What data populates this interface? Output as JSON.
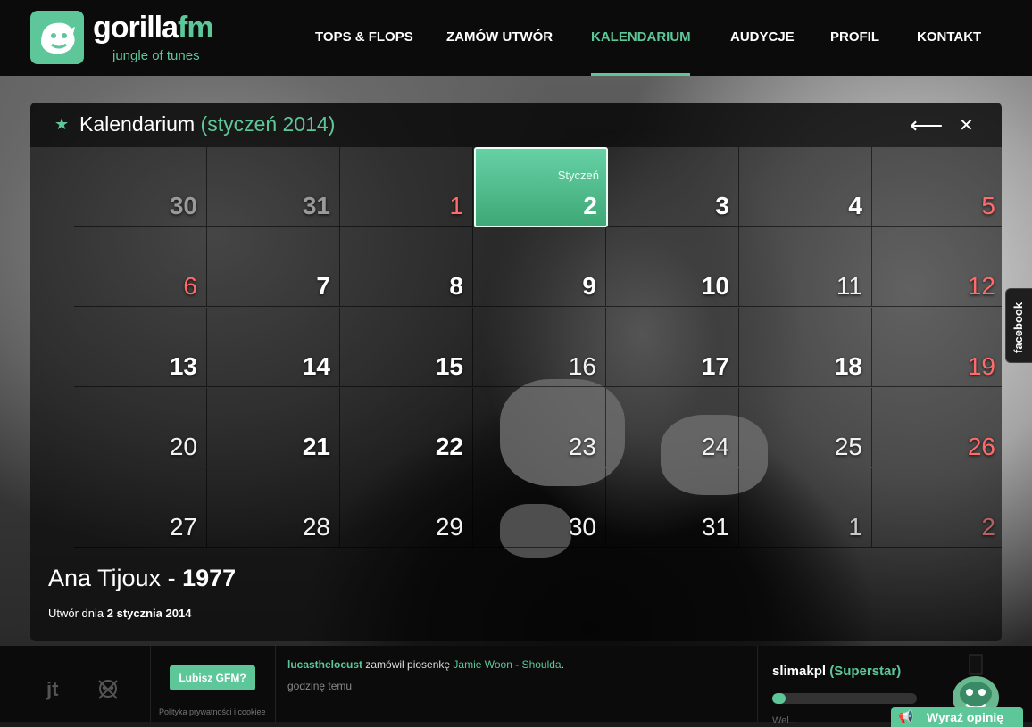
{
  "header": {
    "brand_white": "gorilla",
    "brand_green": "fm",
    "tagline": "jungle of tunes",
    "nav": [
      "TOPS & FLOPS",
      "ZAMÓW UTWÓR",
      "KALENDARIUM",
      "AUDYCJE",
      "PROFIL",
      "KONTAKT"
    ],
    "active_nav": "KALENDARIUM"
  },
  "calendar": {
    "title": "Kalendarium",
    "month_label": "(styczeń 2014)",
    "selected_month_label": "Styczeń",
    "weeks": [
      [
        {
          "d": "30",
          "t": "other"
        },
        {
          "d": "31",
          "t": "other"
        },
        {
          "d": "1",
          "t": "sun"
        },
        {
          "d": "2",
          "t": "selected"
        },
        {
          "d": "3",
          "t": "bold"
        },
        {
          "d": "4",
          "t": "bold"
        },
        {
          "d": "5",
          "t": "sun"
        }
      ],
      [
        {
          "d": "6",
          "t": "sun"
        },
        {
          "d": "7",
          "t": "bold"
        },
        {
          "d": "8",
          "t": "bold"
        },
        {
          "d": "9",
          "t": "bold"
        },
        {
          "d": "10",
          "t": "bold"
        },
        {
          "d": "11",
          "t": "light"
        },
        {
          "d": "12",
          "t": "sun light"
        }
      ],
      [
        {
          "d": "13",
          "t": "bold"
        },
        {
          "d": "14",
          "t": "bold"
        },
        {
          "d": "15",
          "t": "bold"
        },
        {
          "d": "16",
          "t": "light"
        },
        {
          "d": "17",
          "t": "bold"
        },
        {
          "d": "18",
          "t": "bold"
        },
        {
          "d": "19",
          "t": "sun"
        }
      ],
      [
        {
          "d": "20",
          "t": "light"
        },
        {
          "d": "21",
          "t": "bold"
        },
        {
          "d": "22",
          "t": "bold"
        },
        {
          "d": "23",
          "t": "light"
        },
        {
          "d": "24",
          "t": "light"
        },
        {
          "d": "25",
          "t": "light"
        },
        {
          "d": "26",
          "t": "sun light"
        }
      ],
      [
        {
          "d": "27",
          "t": "light"
        },
        {
          "d": "28",
          "t": "light"
        },
        {
          "d": "29",
          "t": "light"
        },
        {
          "d": "30",
          "t": "light"
        },
        {
          "d": "31",
          "t": "light"
        },
        {
          "d": "1",
          "t": "other light"
        },
        {
          "d": "2",
          "t": "other sun"
        }
      ]
    ],
    "song_artist": "Ana Tijoux - ",
    "song_title": "1977",
    "date_prefix": "Utwór dnia ",
    "date_value": "2 stycznia 2014"
  },
  "side_tab": {
    "label": "facebook"
  },
  "footer": {
    "jt": "jt",
    "like_button": "Lubisz GFM?",
    "privacy": "Polityka prywatności i cookiee",
    "activity_user": "lucasthelocust",
    "activity_text": " zamówił piosenkę ",
    "activity_track": "Jamie Woon - Shoulda",
    "activity_end": ".",
    "activity_time": "godzinę temu",
    "username": "slimakpl",
    "rank": "(Superstar)",
    "progress": 0.09,
    "welcome": "Wel...",
    "opinion_button": "Wyraź opinię"
  },
  "colors": {
    "accent": "#5ec79a",
    "sunday": "#ff6b6b",
    "header_bg": "#0b0b0b"
  },
  "icons": [
    "gorilla-logo-icon",
    "star-icon",
    "arrow-left-icon",
    "close-icon",
    "skull-icon",
    "megaphone-icon",
    "mascot-icon"
  ]
}
